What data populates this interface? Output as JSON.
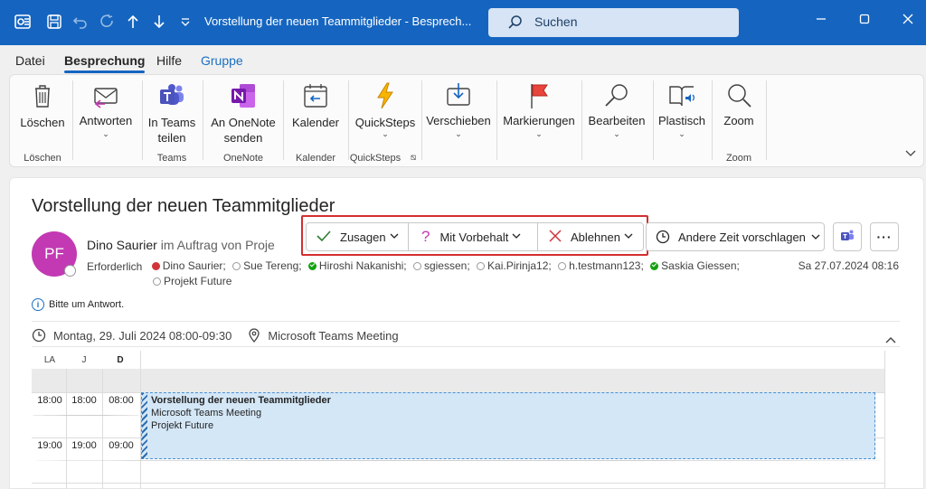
{
  "titlebar": {
    "title": "Vorstellung der neuen Teammitglieder  -  Besprech...",
    "search_placeholder": "Suchen",
    "accent": "#1565c0"
  },
  "menu": {
    "tabs": [
      {
        "label": "Datei"
      },
      {
        "label": "Besprechung"
      },
      {
        "label": "Hilfe"
      },
      {
        "label": "Gruppe"
      }
    ]
  },
  "ribbon": {
    "buttons": [
      {
        "label": "Löschen",
        "icon": "trash-icon"
      },
      {
        "label": "Antworten",
        "icon": "reply-envelope-icon"
      },
      {
        "label": "In Teams\nteilen",
        "icon": "teams-share-icon"
      },
      {
        "label": "An OneNote\nsenden",
        "icon": "onenote-icon"
      },
      {
        "label": "Kalender",
        "icon": "calendar-icon"
      },
      {
        "label": "QuickSteps",
        "icon": "lightning-icon"
      },
      {
        "label": "Verschieben",
        "icon": "move-icon"
      },
      {
        "label": "Markierungen",
        "icon": "flag-icon"
      },
      {
        "label": "Bearbeiten",
        "icon": "search-edit-icon"
      },
      {
        "label": "Plastisch",
        "icon": "immersive-reader-icon"
      },
      {
        "label": "Zoom",
        "icon": "zoom-icon"
      }
    ],
    "groups": [
      "Löschen",
      "Teams",
      "OneNote",
      "Kalender",
      "QuickSteps",
      "Zoom"
    ]
  },
  "meeting": {
    "subject": "Vorstellung der neuen Teammitglieder",
    "avatar_initials": "PF",
    "avatar_color": "#c239b3",
    "sender_name": "Dino Saurier",
    "sender_suffix": " im Auftrag von Proje",
    "required_label": "Erforderlich",
    "attendees": [
      {
        "name": "Dino Saurier;",
        "status": "red"
      },
      {
        "name": "Sue Tereng;",
        "status": "empty"
      },
      {
        "name": "Hiroshi Nakanishi;",
        "status": "green"
      },
      {
        "name": "sgiessen;",
        "status": "empty"
      },
      {
        "name": "Kai.Pirinja12;",
        "status": "empty"
      },
      {
        "name": "h.testmann123;",
        "status": "empty"
      },
      {
        "name": "Saskia Giessen;",
        "status": "green"
      },
      {
        "name": "Projekt Future",
        "status": "empty"
      }
    ],
    "sent_date": "Sa 27.07.2024 08:16",
    "info_text": "Bitte um Antwort.",
    "when": "Montag, 29. Juli 2024 08:00-09:30",
    "location": "Microsoft Teams Meeting"
  },
  "response": {
    "accept": "Zusagen",
    "tentative": "Mit Vorbehalt",
    "decline": "Ablehnen",
    "propose": "Andere Zeit vorschlagen"
  },
  "calendar": {
    "timezones": [
      "LA",
      "J",
      "D"
    ],
    "rows": [
      {
        "la": "18:00",
        "j": "18:00",
        "d": "08:00"
      },
      {
        "la": "19:00",
        "j": "19:00",
        "d": "09:00"
      }
    ],
    "event": {
      "title": "Vorstellung der neuen Teammitglieder",
      "line1": "Microsoft Teams Meeting",
      "line2": "Projekt Future"
    }
  }
}
